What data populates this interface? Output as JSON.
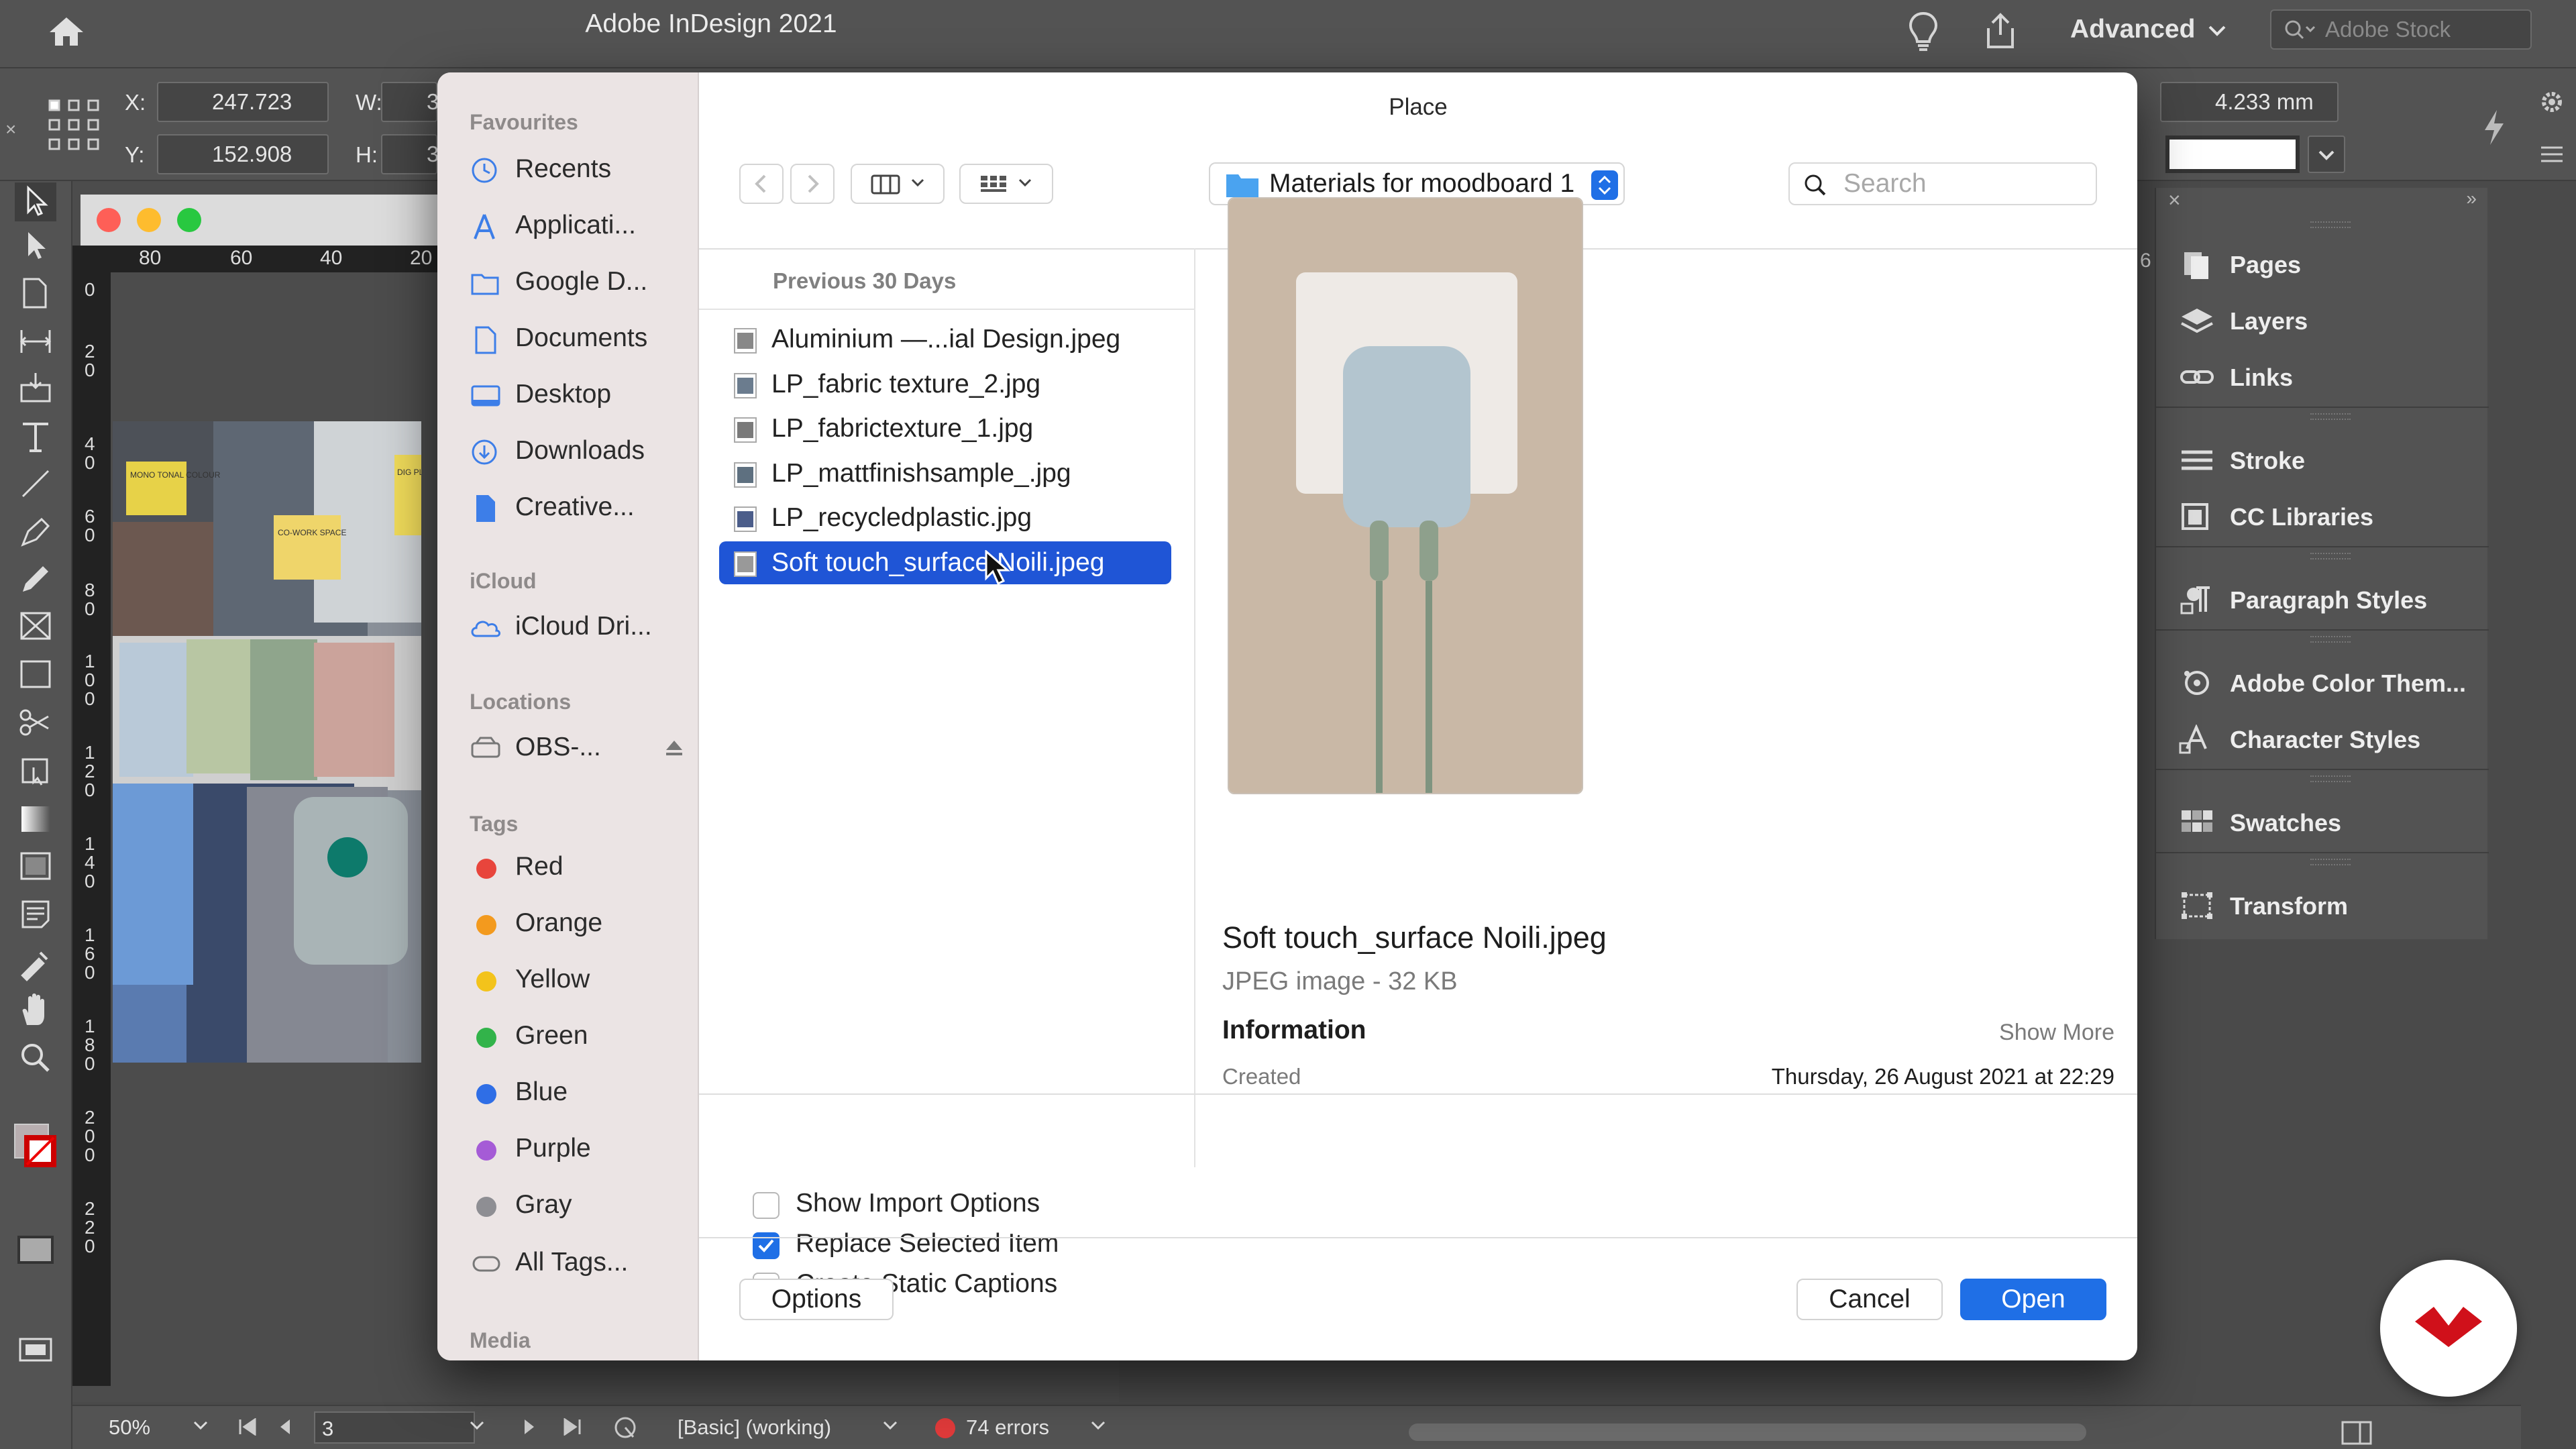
{
  "app": {
    "title": "Adobe InDesign 2021",
    "workspace": "Advanced",
    "stock_placeholder": "Adobe Stock"
  },
  "control": {
    "x_label": "X:",
    "x_value": "247.723 mm",
    "y_label": "Y:",
    "y_value": "152.908 mm",
    "w_label": "W:",
    "w_value": "3",
    "h_label": "H:",
    "h_value": "3",
    "stroke_value": "4.233 mm"
  },
  "document": {
    "ruler_top": [
      "80",
      "60",
      "40",
      "20"
    ],
    "ruler_left": [
      "0",
      "2",
      "0",
      "4",
      "0",
      "6",
      "0",
      "8",
      "0",
      "1",
      "0",
      "0",
      "1",
      "2",
      "0",
      "1",
      "4",
      "0",
      "1",
      "6",
      "0",
      "1",
      "8",
      "0",
      "2",
      "0",
      "0",
      "2",
      "2",
      "0"
    ],
    "ruler_right": "6",
    "sticky_1": "MONO TONAL COLOUR",
    "sticky_2": "CO-WORK SPACE",
    "sticky_3": "DIG PL"
  },
  "status": {
    "zoom": "50%",
    "page": "3",
    "profile": "[Basic] (working)",
    "errors": "74 errors"
  },
  "panels": [
    {
      "label": "Pages",
      "icon": "pages-icon"
    },
    {
      "label": "Layers",
      "icon": "layers-icon"
    },
    {
      "label": "Links",
      "icon": "links-icon"
    },
    {
      "label": "Stroke",
      "icon": "stroke-icon"
    },
    {
      "label": "CC Libraries",
      "icon": "cc-libraries-icon"
    },
    {
      "label": "Paragraph Styles",
      "icon": "paragraph-styles-icon"
    },
    {
      "label": "Adobe Color Them...",
      "icon": "adobe-color-themes-icon"
    },
    {
      "label": "Character Styles",
      "icon": "character-styles-icon"
    },
    {
      "label": "Swatches",
      "icon": "swatches-icon"
    },
    {
      "label": "Transform",
      "icon": "transform-icon"
    }
  ],
  "dialog": {
    "title": "Place",
    "location": "Materials for moodboard 1",
    "search_placeholder": "Search",
    "sidebar": {
      "favourites_header": "Favourites",
      "favourites": [
        "Recents",
        "Applicati...",
        "Google D...",
        "Documents",
        "Desktop",
        "Downloads",
        "Creative..."
      ],
      "icloud_header": "iCloud",
      "icloud": [
        "iCloud Dri..."
      ],
      "locations_header": "Locations",
      "locations": [
        "OBS-..."
      ],
      "tags_header": "Tags",
      "tags": [
        {
          "label": "Red",
          "color": "#e8453c"
        },
        {
          "label": "Orange",
          "color": "#f39a1e"
        },
        {
          "label": "Yellow",
          "color": "#f3c31b"
        },
        {
          "label": "Green",
          "color": "#32b34a"
        },
        {
          "label": "Blue",
          "color": "#2f6ee6"
        },
        {
          "label": "Purple",
          "color": "#a55bd6"
        },
        {
          "label": "Gray",
          "color": "#8e8e93"
        }
      ],
      "all_tags": "All Tags...",
      "media_header": "Media"
    },
    "list_header": "Previous 30 Days",
    "files": [
      {
        "name": "Aluminium —...ial Design.jpeg",
        "selected": false
      },
      {
        "name": "LP_fabric texture_2.jpg",
        "selected": false
      },
      {
        "name": "LP_fabrictexture_1.jpg",
        "selected": false
      },
      {
        "name": "LP_mattfinishsample_.jpg",
        "selected": false
      },
      {
        "name": "LP_recycledplastic.jpg",
        "selected": false
      },
      {
        "name": "Soft touch_surface Noili.jpeg",
        "selected": true
      }
    ],
    "preview": {
      "name": "Soft touch_surface Noili.jpeg",
      "kind": "JPEG image - 32 KB",
      "info_header": "Information",
      "show_more": "Show More",
      "created_label": "Created",
      "created_value": "Thursday, 26 August 2021 at 22:29"
    },
    "options": [
      {
        "label": "Show Import Options",
        "checked": false
      },
      {
        "label": "Replace Selected Item",
        "checked": true
      },
      {
        "label": "Create Static Captions",
        "checked": false
      }
    ],
    "buttons": {
      "options": "Options",
      "cancel": "Cancel",
      "open": "Open"
    }
  },
  "colors": {
    "accent": "#1f6fe6",
    "selection": "#1f55d6",
    "brand_logo": "#d0101a"
  }
}
